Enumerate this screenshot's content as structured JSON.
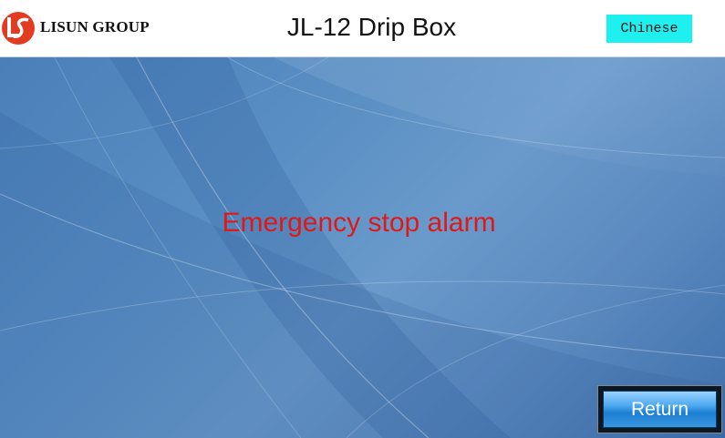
{
  "header": {
    "brand": "LISUN GROUP",
    "title": "JL-12 Drip Box",
    "language_button": "Chinese"
  },
  "main": {
    "alarm_message": "Emergency stop alarm",
    "return_button": "Return"
  },
  "colors": {
    "language_button_bg": "#1ef0f0",
    "alarm_text": "#e01818",
    "logo_red": "#e33a22"
  },
  "icons": {
    "logo": "lisun-logo-icon"
  }
}
